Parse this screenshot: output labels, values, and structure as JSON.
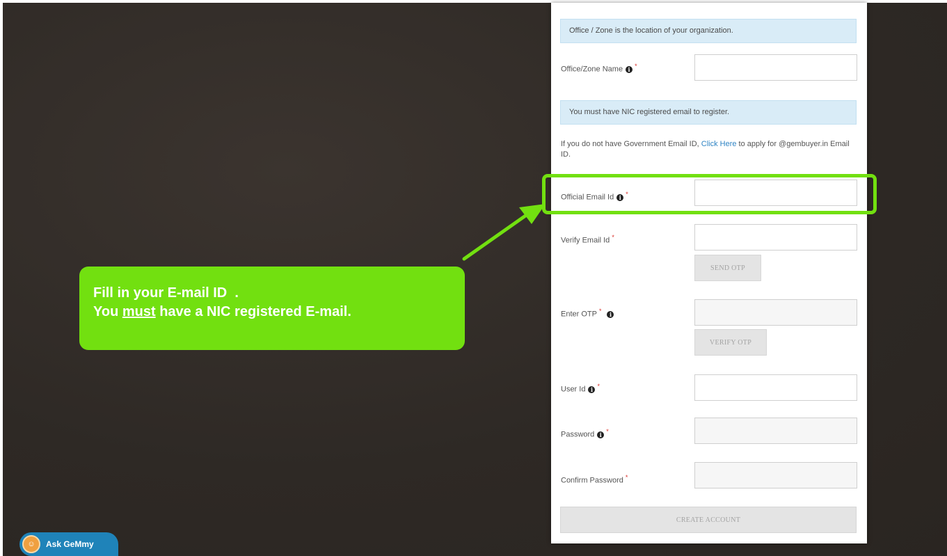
{
  "form": {
    "office_info": "Office / Zone is the location of your organization.",
    "office_zone_label": "Office/Zone Name",
    "nic_info": "You must have NIC registered email to register.",
    "note_prefix": "If you do not have Government Email ID, ",
    "note_link": "Click Here",
    "note_suffix": " to apply for @gembuyer.in Email ID.",
    "official_email_label": "Official Email Id",
    "verify_email_label": "Verify Email Id",
    "send_otp_label": "SEND OTP",
    "enter_otp_label": "Enter OTP",
    "verify_otp_label": "VERIFY OTP",
    "user_id_label": "User Id",
    "password_label": "Password",
    "confirm_password_label": "Confirm Password",
    "create_account_label": "CREATE ACCOUNT",
    "required_mark": "*",
    "info_icon_glyph": "i"
  },
  "annotation": {
    "line1": "Fill in your E-mail ID  .",
    "line2_prefix": "You ",
    "line2_emphasis": "must",
    "line2_suffix": " have a NIC registered E-mail.",
    "accent_color": "#72e010"
  },
  "assistant": {
    "label": "Ask GeMmy",
    "avatar_icon": "gemmy-avatar-icon"
  }
}
